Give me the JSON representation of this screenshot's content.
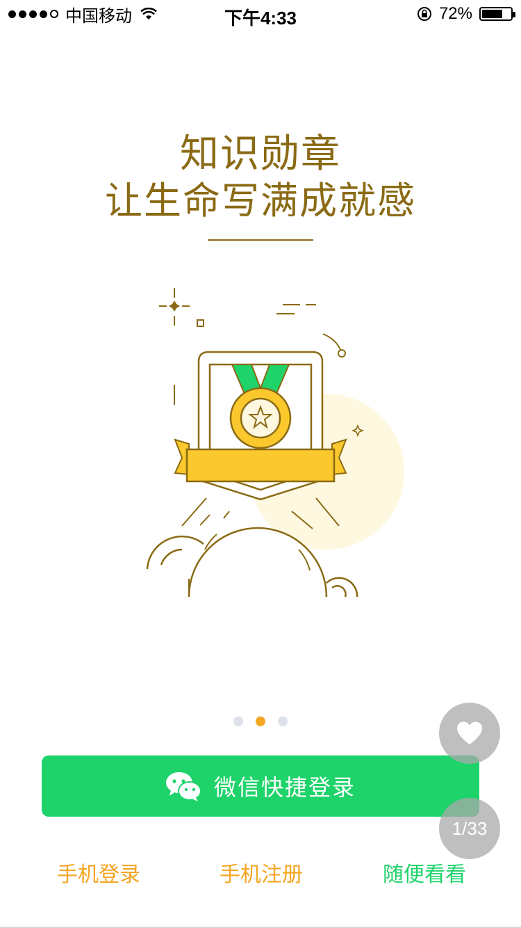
{
  "status_bar": {
    "carrier": "中国移动",
    "time": "下午4:33",
    "battery": "72%"
  },
  "headline": {
    "line1": "知识勋章",
    "line2": "让生命写满成就感"
  },
  "pager_dots": {
    "count": 3,
    "active_index": 1
  },
  "wechat_login": {
    "label": "微信快捷登录",
    "icon": "wechat-icon"
  },
  "links": {
    "phone_login": "手机登录",
    "phone_register": "手机注册",
    "browse": "随便看看"
  },
  "floating": {
    "favorite_icon": "heart-icon",
    "page_counter": "1/33"
  },
  "colors": {
    "brand_green": "#1fd36b",
    "accent_orange": "#f5a623",
    "headline_brown": "#8a6a14",
    "medal_yellow": "#fbc82d"
  }
}
